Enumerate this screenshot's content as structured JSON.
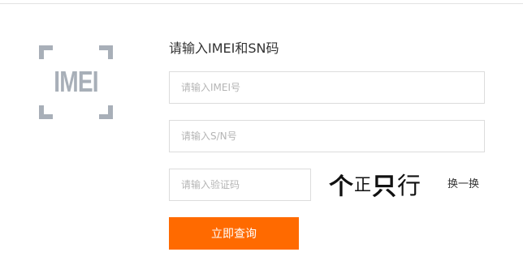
{
  "logo": {
    "text": "IMEI",
    "color": "#a8afb8"
  },
  "form": {
    "title": "请输入IMEI和SN码",
    "imei_placeholder": "请输入IMEI号",
    "sn_placeholder": "请输入S/N号",
    "captcha_placeholder": "请输入验证码",
    "captcha_chars": [
      "个",
      "正",
      "只",
      "行"
    ],
    "refresh_label": "换一换",
    "submit_label": "立即查询"
  },
  "colors": {
    "accent": "#ff6a00",
    "border": "#dcdcdc",
    "placeholder": "#b5b5b5"
  }
}
